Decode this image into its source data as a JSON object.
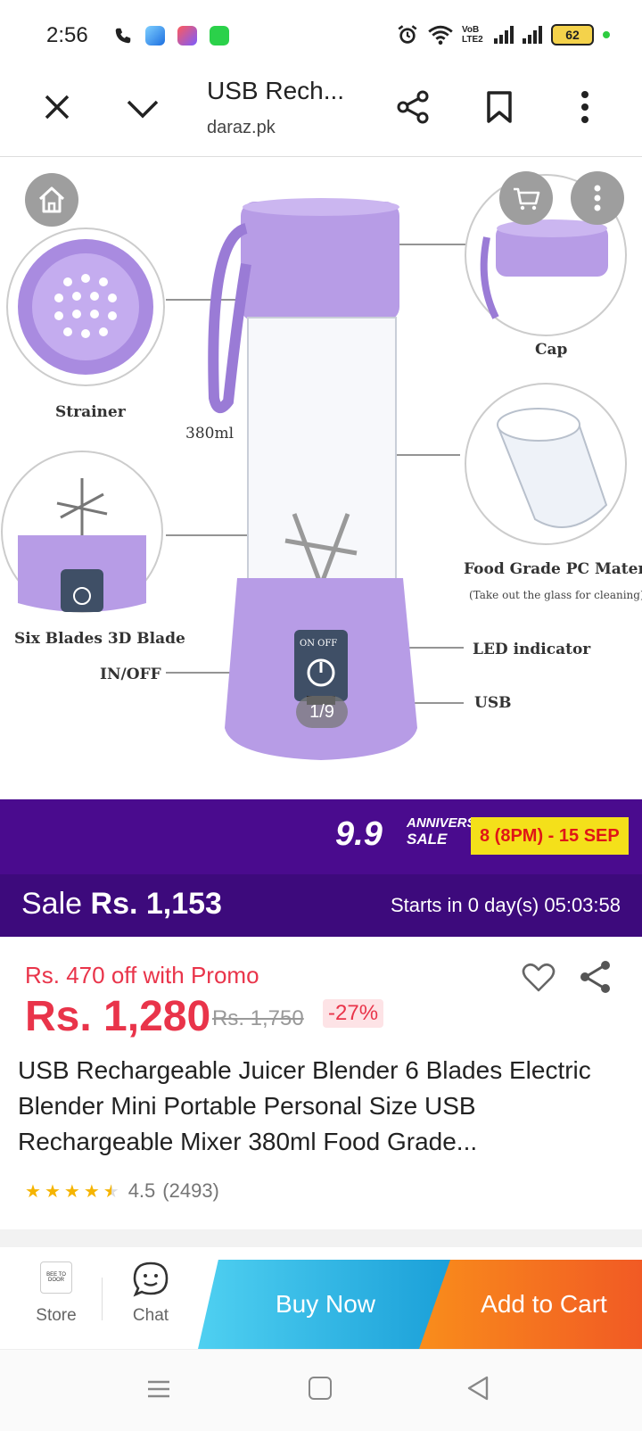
{
  "status_bar": {
    "time": "2:56",
    "network_label": "VoB LTE2",
    "battery": "62",
    "icons": [
      "phone-icon",
      "browser-app-icon",
      "star-app-icon",
      "green-app-icon",
      "alarm-icon",
      "wifi-icon",
      "signal-icon",
      "signal-icon-2"
    ]
  },
  "browser": {
    "title": "USB Rech...",
    "domain": "daraz.pk",
    "icons": [
      "close-icon",
      "chevron-down-icon",
      "share-icon",
      "bookmark-icon",
      "more-vertical-icon"
    ]
  },
  "gallery": {
    "pager": "1/9",
    "labels": {
      "strainer": "Strainer",
      "capacity": "380ml",
      "cap": "Cap",
      "material": "Food Grade PC Material",
      "material_note": "(Take out the glass for cleaning)",
      "blades": "Six Blades 3D Blade",
      "switch": "IN/OFF",
      "led": "LED indicator",
      "usb": "USB",
      "on_off": "ON OFF"
    },
    "colors": {
      "blender": "#b79ce6",
      "blender_dark": "#9a7bd6"
    }
  },
  "promo": {
    "nine": "9.9",
    "anniversary": "ANNIVERSARY",
    "sale": "SALE",
    "date_range": "8 (8PM) - 15 SEP",
    "colors": {
      "banner": "#4a0b8e",
      "date_bg": "#f4e01a",
      "date_text": "#e01616"
    }
  },
  "sale": {
    "prefix": "Sale",
    "price": "Rs. 1,153",
    "countdown": "Starts in 0 day(s) 05:03:58"
  },
  "pricing": {
    "promo_line": "Rs. 470 off with Promo",
    "current_price": "Rs. 1,280",
    "original_price": "Rs. 1,750",
    "discount": "-27%",
    "accent": "#e9344a"
  },
  "product": {
    "title": "USB Rechargeable Juicer Blender 6 Blades Electric Blender Mini Portable Personal Size USB Rechargeable Mixer 380ml Food Grade...",
    "rating": {
      "stars": 4.5,
      "score": "4.5",
      "count": "(2493)"
    }
  },
  "actions": {
    "store_label": "Store",
    "store_logo_text": "BEE TO DOOR",
    "chat_label": "Chat",
    "buy_now": "Buy Now",
    "add_to_cart": "Add to Cart"
  }
}
